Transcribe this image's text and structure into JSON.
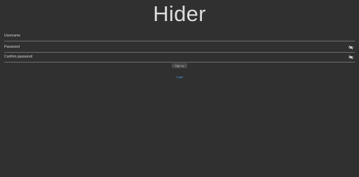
{
  "app": {
    "title": "Hider"
  },
  "form": {
    "username": {
      "placeholder": "Username",
      "value": ""
    },
    "password": {
      "placeholder": "Password",
      "value": "",
      "toggle_icon": "eye-slash-icon"
    },
    "confirm_password": {
      "placeholder": "Confirm password",
      "value": "",
      "toggle_icon": "eye-slash-icon"
    },
    "signup_label": "Sign up",
    "login_label": "Login"
  },
  "colors": {
    "background": "#303030",
    "link": "#4fa3f7",
    "button_bg": "#4a4a4a",
    "divider": "#6e6e6e"
  }
}
